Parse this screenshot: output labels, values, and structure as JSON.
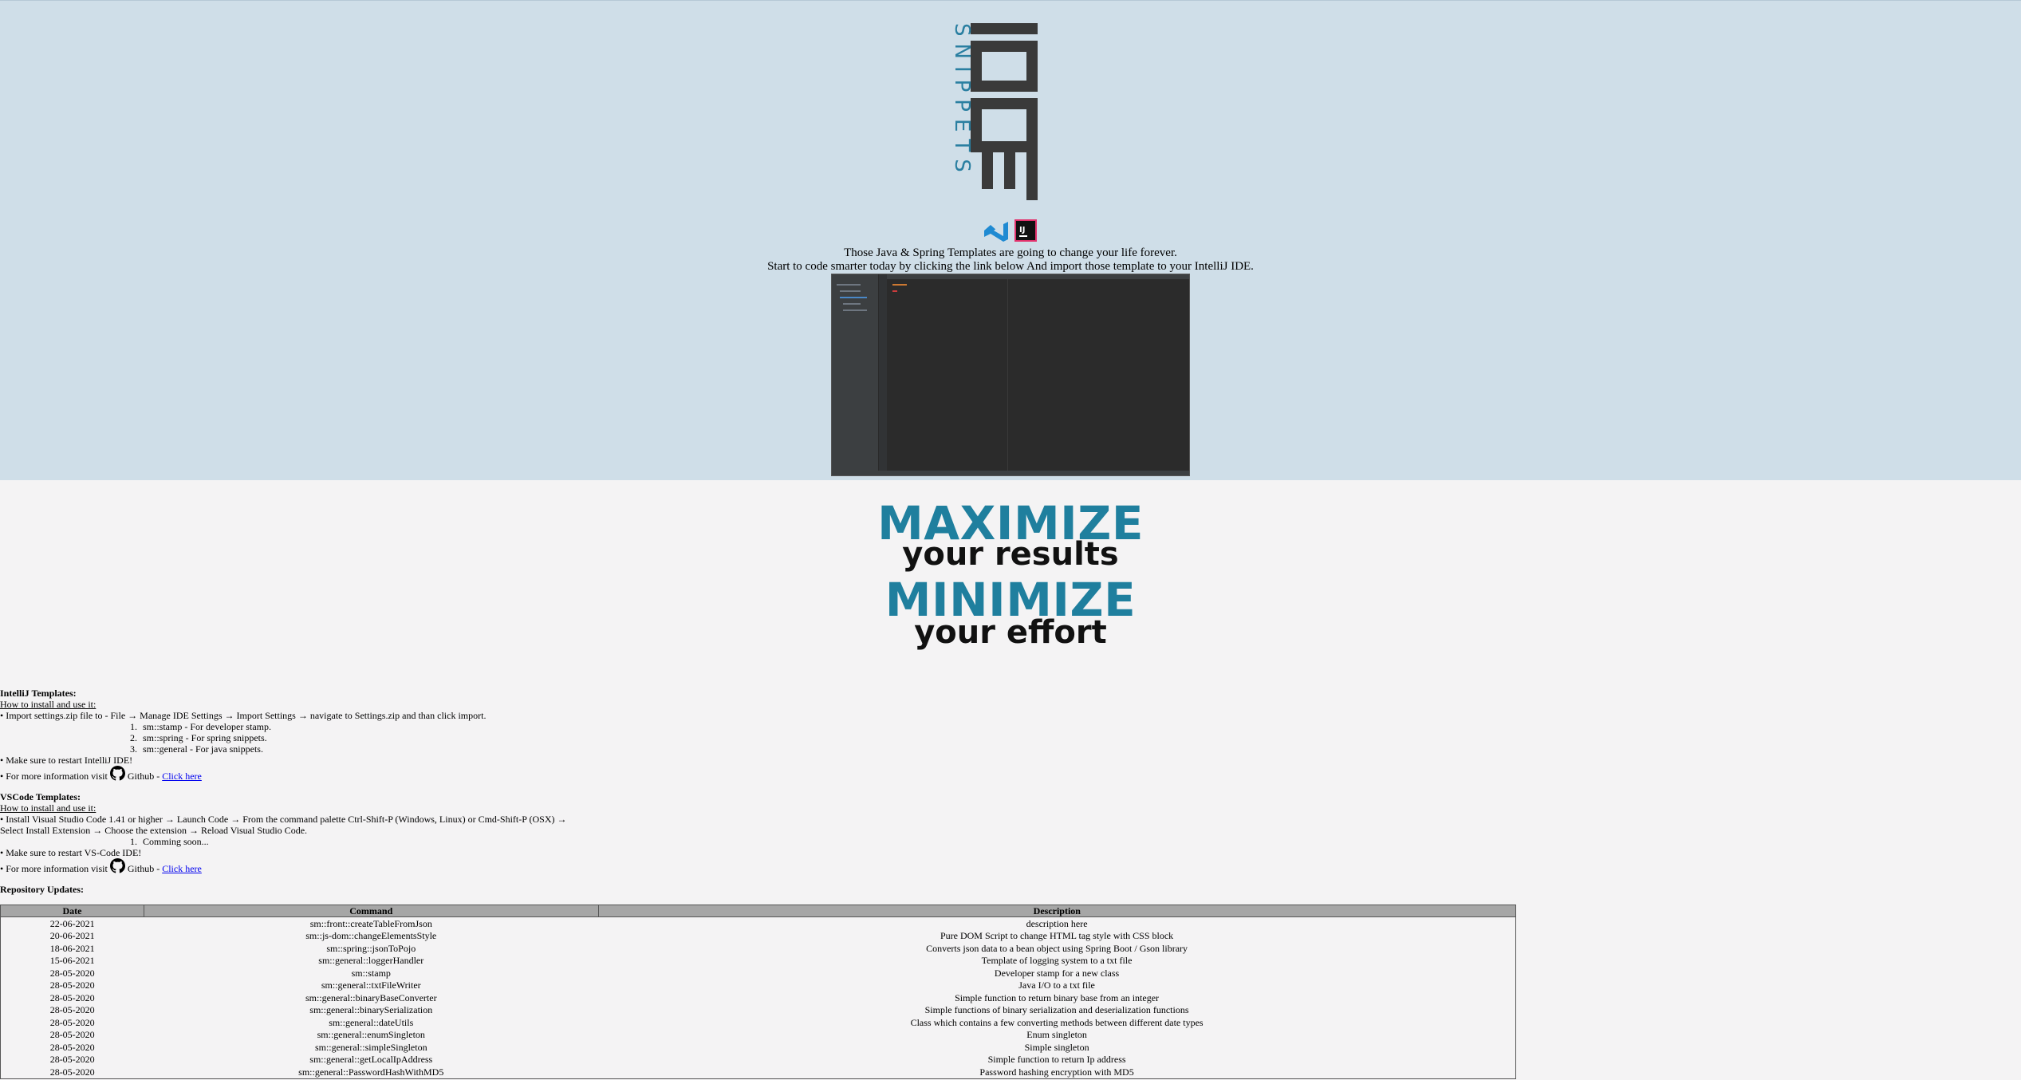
{
  "logo": {
    "brand_text": "SNIPPETS",
    "mark_text": "IDE",
    "accent": "#2a7fa1",
    "mark_color": "#3a3a3a"
  },
  "ide_icons": [
    "vscode-icon",
    "intellij-icon"
  ],
  "header": {
    "tagline_1": "Those Java & Spring Templates are going to change your life forever.",
    "tagline_2": "Start to code smarter today by clicking the link below And import those template to your IntelliJ IDE."
  },
  "slogan": {
    "line1": "MAXIMIZE",
    "line2": "your results",
    "line3": "MINIMIZE",
    "line4": "your effort",
    "accent": "#1f7f9e"
  },
  "intellij": {
    "heading": "IntelliJ Templates:",
    "howto": "How to install and use it:",
    "step": "• Import settings.zip file to - File → Manage IDE Settings → Import Settings → navigate to Settings.zip and than click import.",
    "items": [
      "sm::stamp - For developer stamp.",
      "sm::spring - For spring snippets.",
      "sm::general - For java snippets."
    ],
    "restart": "• Make sure to restart IntelliJ IDE!",
    "info_prefix": "• For more information visit",
    "github_label": "Github -",
    "link_text": "Click here"
  },
  "vscode": {
    "heading": "VSCode Templates:",
    "howto": "How to install and use it:",
    "step_1": "• Install Visual Studio Code 1.41 or higher → Launch Code → From the command palette Ctrl-Shift-P (Windows, Linux) or Cmd-Shift-P (OSX) →",
    "step_2": "Select Install Extension → Choose the extension → Reload Visual Studio Code.",
    "items": [
      "Comming soon..."
    ],
    "restart": "• Make sure to restart VS-Code IDE!",
    "info_prefix": "• For more information visit",
    "github_label": "Github -",
    "link_text": "Click here"
  },
  "updates": {
    "heading": "Repository Updates:",
    "columns": [
      "Date",
      "Command",
      "Description"
    ],
    "rows": [
      [
        "22-06-2021",
        "sm::front::createTableFromJson",
        "description here"
      ],
      [
        "20-06-2021",
        "sm::js-dom::changeElementsStyle",
        "Pure DOM Script to change HTML tag style with CSS block"
      ],
      [
        "18-06-2021",
        "sm::spring::jsonToPojo",
        "Converts json data to a bean object using Spring Boot / Gson library"
      ],
      [
        "15-06-2021",
        "sm::general::loggerHandler",
        "Template of logging system to a txt file"
      ],
      [
        "28-05-2020",
        "sm::stamp",
        "Developer stamp for a new class"
      ],
      [
        "28-05-2020",
        "sm::general::txtFileWriter",
        "Java I/O to a txt file"
      ],
      [
        "28-05-2020",
        "sm::general::binaryBaseConverter",
        "Simple function to return binary base from an integer"
      ],
      [
        "28-05-2020",
        "sm::general::binarySerialization",
        "Simple functions of binary serialization and deserialization functions"
      ],
      [
        "28-05-2020",
        "sm::general::dateUtils",
        "Class which contains a few converting methods between different date types"
      ],
      [
        "28-05-2020",
        "sm::general::enumSingleton",
        "Enum singleton"
      ],
      [
        "28-05-2020",
        "sm::general::simpleSingleton",
        "Simple singleton"
      ],
      [
        "28-05-2020",
        "sm::general::getLocalIpAddress",
        "Simple function to return Ip address"
      ],
      [
        "28-05-2020",
        "sm::general::PasswordHashWithMD5",
        "Password hashing encryption with MD5"
      ]
    ]
  }
}
